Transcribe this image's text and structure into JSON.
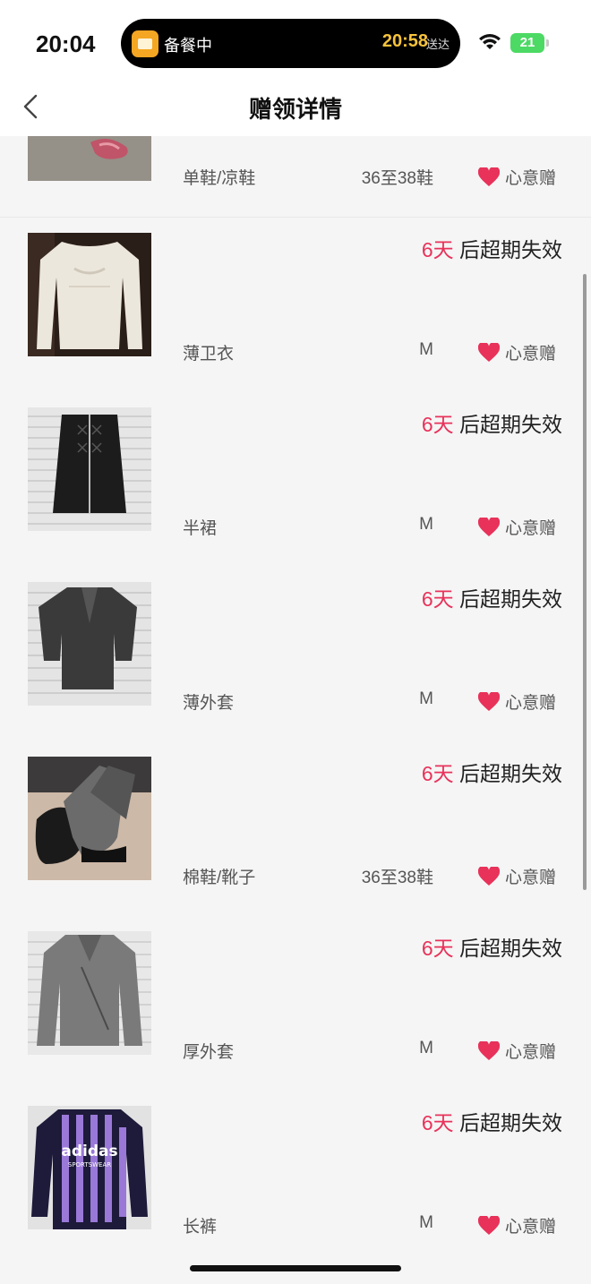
{
  "status_bar": {
    "time": "20:04",
    "island_label": "备餐中",
    "island_eta": "20:58",
    "island_eta_suffix": "送达",
    "battery": "21"
  },
  "nav": {
    "title": "赠领详情"
  },
  "items": [
    {
      "expire_days": "",
      "expire_text": "",
      "name": "单鞋/凉鞋",
      "size": "36至38鞋",
      "tag": "心意赠"
    },
    {
      "expire_days": "6天",
      "expire_text": "后超期失效",
      "name": "薄卫衣",
      "size": "M",
      "tag": "心意赠"
    },
    {
      "expire_days": "6天",
      "expire_text": "后超期失效",
      "name": "半裙",
      "size": "M",
      "tag": "心意赠"
    },
    {
      "expire_days": "6天",
      "expire_text": "后超期失效",
      "name": "薄外套",
      "size": "M",
      "tag": "心意赠"
    },
    {
      "expire_days": "6天",
      "expire_text": "后超期失效",
      "name": "棉鞋/靴子",
      "size": "36至38鞋",
      "tag": "心意赠"
    },
    {
      "expire_days": "6天",
      "expire_text": "后超期失效",
      "name": "厚外套",
      "size": "M",
      "tag": "心意赠"
    },
    {
      "expire_days": "6天",
      "expire_text": "后超期失效",
      "name": "长裤",
      "size": "M",
      "tag": "心意赠"
    }
  ],
  "photo_text": {
    "adidas": "adidas",
    "sportswear": "SPORTSWEAR"
  },
  "colors": {
    "accent_red": "#e8325a",
    "heart": "#e8325a"
  }
}
